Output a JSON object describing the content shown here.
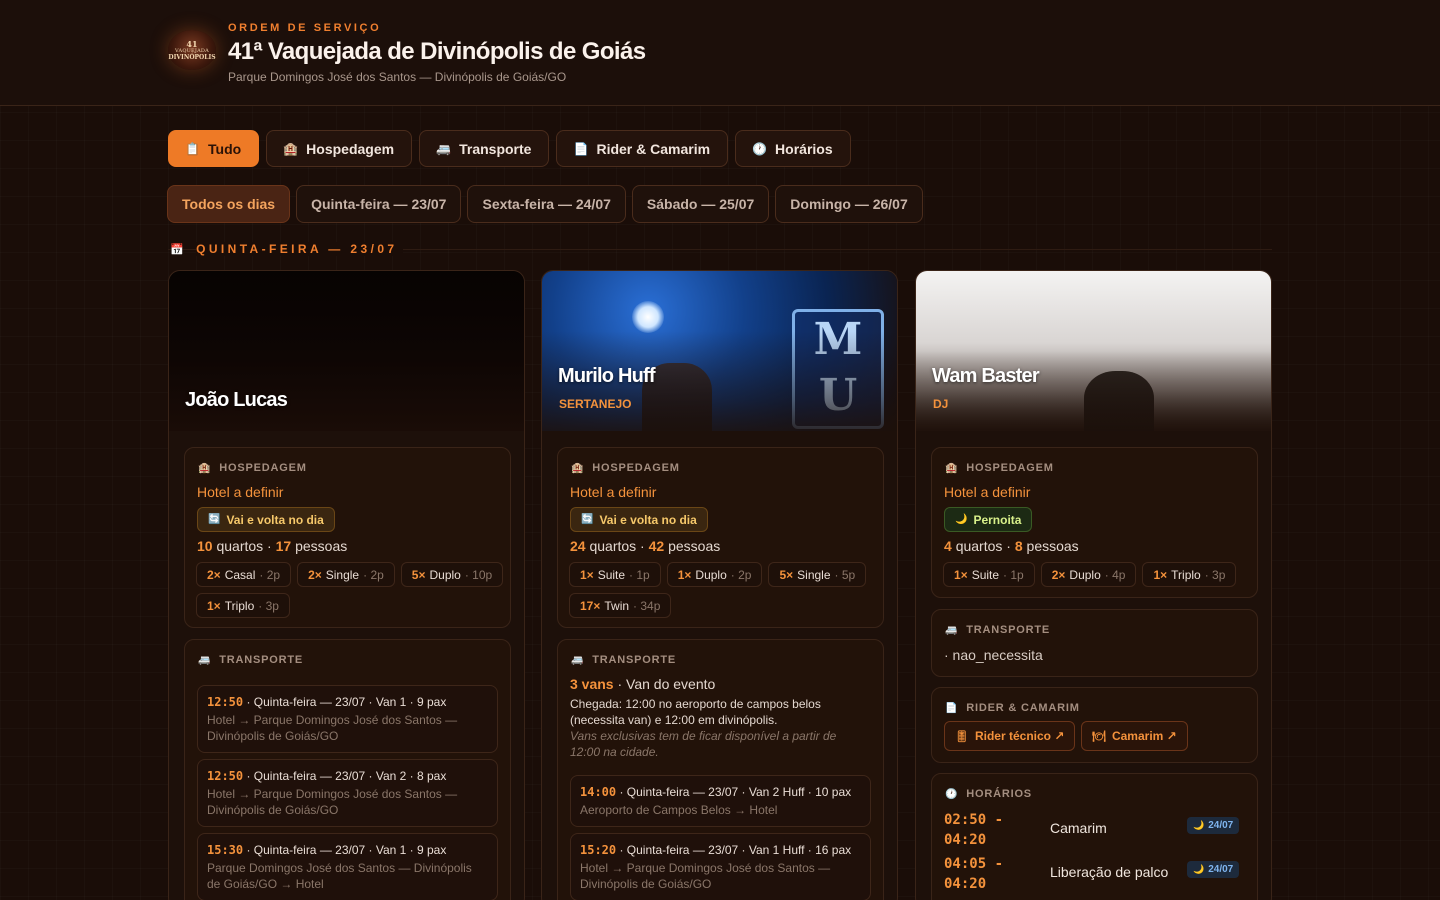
{
  "header": {
    "eyebrow": "ORDEM DE SERVIÇO",
    "title": "41ª Vaquejada de Divinópolis de Goiás",
    "subtitle": "Parque Domingos José dos Santos — Divinópolis de Goiás/GO",
    "logo": {
      "line1": "41",
      "line2": "VAQUEJADA",
      "line3": "DIVINÓPOLIS"
    }
  },
  "tabs": [
    {
      "icon": "📋",
      "label": "Tudo",
      "active": true
    },
    {
      "icon": "🏨",
      "label": "Hospedagem"
    },
    {
      "icon": "🚐",
      "label": "Transporte"
    },
    {
      "icon": "📄",
      "label": "Rider & Camarim"
    },
    {
      "icon": "🕐",
      "label": "Horários"
    }
  ],
  "days": [
    {
      "label": "Todos os dias",
      "active": true
    },
    {
      "label": "Quinta-feira — 23/07"
    },
    {
      "label": "Sexta-feira — 24/07"
    },
    {
      "label": "Sábado — 25/07"
    },
    {
      "label": "Domingo — 26/07"
    }
  ],
  "section": {
    "icon": "📅",
    "label": "QUINTA-FEIRA — 23/07"
  },
  "labels": {
    "hospedagem": "HOSPEDAGEM",
    "transporte": "TRANSPORTE",
    "rider": "RIDER & CAMARIM",
    "horarios": "HORÁRIOS",
    "quartos": "quartos",
    "pessoas": "pessoas"
  },
  "artists": [
    {
      "name": "João Lucas",
      "genre": "",
      "hotel": "Hotel a definir",
      "badge": "Vai e volta no dia",
      "badge_icon": "🔄",
      "rooms": "10",
      "people": "17",
      "room_types": [
        {
          "qty": "2×",
          "type": "Casal",
          "cap": "· 2p"
        },
        {
          "qty": "2×",
          "type": "Single",
          "cap": "· 2p"
        },
        {
          "qty": "5×",
          "type": "Duplo",
          "cap": "· 10p"
        },
        {
          "qty": "1×",
          "type": "Triplo",
          "cap": "· 3p"
        }
      ],
      "trips": [
        {
          "time": "12:50",
          "info": " · Quinta-feira — 23/07 · Van 1 · 9 pax",
          "route": "Hotel → Parque Domingos José dos Santos — Divinópolis de Goiás/GO"
        },
        {
          "time": "12:50",
          "info": " · Quinta-feira — 23/07 · Van 2 · 8 pax",
          "route": "Hotel → Parque Domingos José dos Santos — Divinópolis de Goiás/GO"
        },
        {
          "time": "15:30",
          "info": " · Quinta-feira — 23/07 · Van 1 · 9 pax",
          "route": "Parque Domingos José dos Santos — Divinópolis de Goiás/GO → Hotel"
        }
      ]
    },
    {
      "name": "Murilo Huff",
      "genre": "SERTANEJO",
      "hotel": "Hotel a definir",
      "badge": "Vai e volta no dia",
      "badge_icon": "🔄",
      "rooms": "24",
      "people": "42",
      "room_types": [
        {
          "qty": "1×",
          "type": "Suite",
          "cap": "· 1p"
        },
        {
          "qty": "1×",
          "type": "Duplo",
          "cap": "· 2p"
        },
        {
          "qty": "5×",
          "type": "Single",
          "cap": "· 5p"
        },
        {
          "qty": "17×",
          "type": "Twin",
          "cap": "· 34p"
        }
      ],
      "transport": {
        "vans": "3 vans",
        "desc": " · Van do evento",
        "arrival": "Chegada: 12:00 no aeroporto de campos belos (necessita van) e 12:00 em divinópolis.",
        "note": "Vans exclusivas tem de ficar disponível a partir de 12:00 na cidade."
      },
      "trips": [
        {
          "time": "14:00",
          "info": " · Quinta-feira — 23/07 · Van 2 Huff · 10 pax",
          "route": "Aeroporto de Campos Belos → Hotel"
        },
        {
          "time": "15:20",
          "info": " · Quinta-feira — 23/07 · Van 1 Huff · 16 pax",
          "route": "Hotel → Parque Domingos José dos Santos — Divinópolis de Goiás/GO"
        }
      ]
    },
    {
      "name": "Wam Baster",
      "genre": "DJ",
      "hotel": "Hotel a definir",
      "badge": "Pernoita",
      "badge_icon": "🌙",
      "rooms": "4",
      "people": "8",
      "room_types": [
        {
          "qty": "1×",
          "type": "Suite",
          "cap": "· 1p"
        },
        {
          "qty": "2×",
          "type": "Duplo",
          "cap": "· 4p"
        },
        {
          "qty": "1×",
          "type": "Triplo",
          "cap": "· 3p"
        }
      ],
      "transport_status": "· nao_necessita",
      "rider": {
        "tech": "Rider técnico ↗",
        "camarim": "Camarim ↗"
      },
      "schedule": [
        {
          "time": "02:50 - 04:20",
          "what": "Camarim",
          "date": "24/07"
        },
        {
          "time": "04:05 - 04:20",
          "what": "Liberação de palco",
          "date": "24/07"
        }
      ]
    }
  ],
  "colors": {
    "accent": "#ee7a26",
    "background": "#1a0d08",
    "card": "#1d100a"
  }
}
